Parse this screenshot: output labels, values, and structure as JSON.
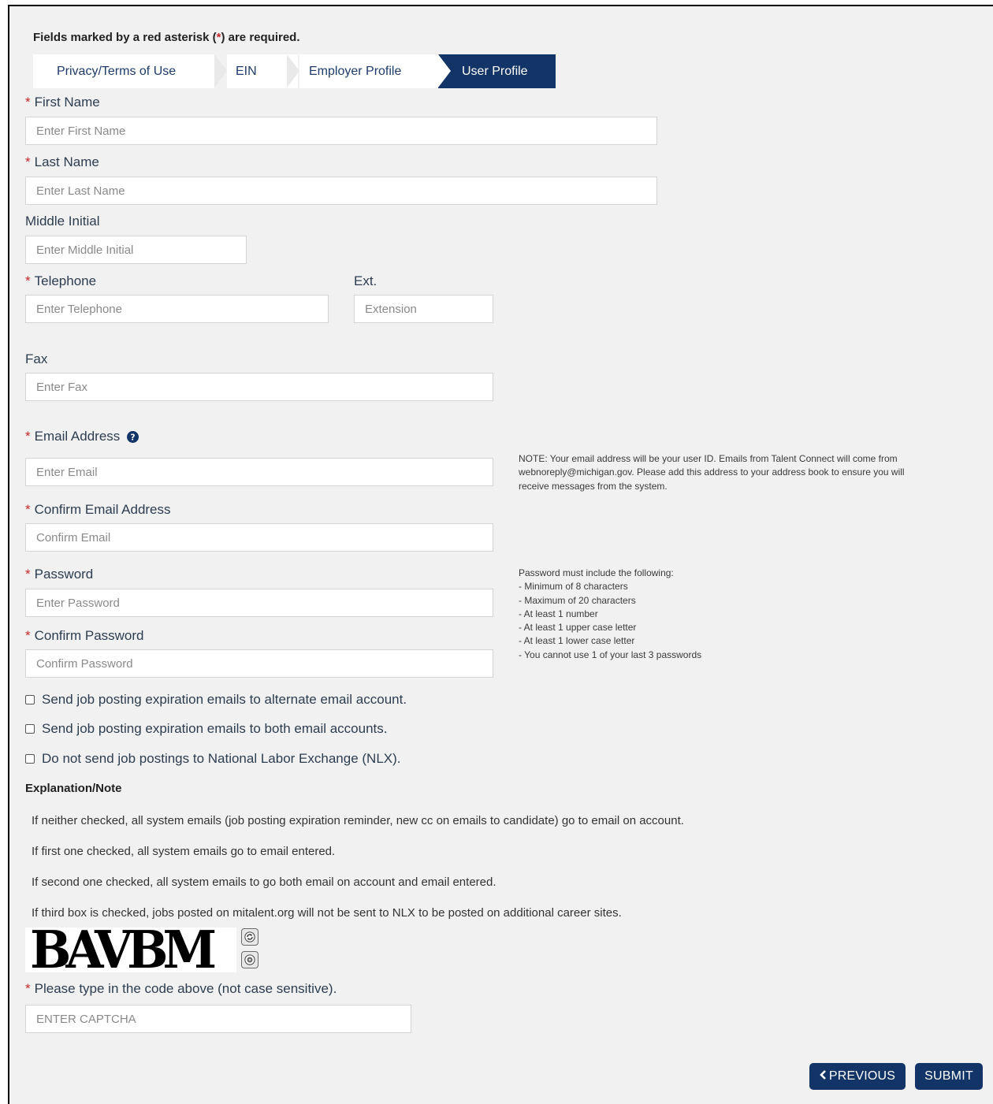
{
  "required_note": {
    "prefix": "Fields marked by a red asterisk (",
    "asterisk": "*",
    "suffix": ") are required."
  },
  "steps": [
    {
      "label": "Privacy/Terms of Use",
      "active": false
    },
    {
      "label": "EIN",
      "active": false
    },
    {
      "label": "Employer Profile",
      "active": false
    },
    {
      "label": "User Profile",
      "active": true
    }
  ],
  "fields": {
    "first_name": {
      "label": "First Name",
      "placeholder": "Enter First Name",
      "value": ""
    },
    "last_name": {
      "label": "Last Name",
      "placeholder": "Enter Last Name",
      "value": ""
    },
    "middle_initial": {
      "label": "Middle Initial",
      "placeholder": "Enter Middle Initial",
      "value": ""
    },
    "telephone": {
      "label": "Telephone",
      "placeholder": "Enter Telephone",
      "value": ""
    },
    "extension": {
      "label": "Ext.",
      "placeholder": "Extension",
      "value": ""
    },
    "fax": {
      "label": "Fax",
      "placeholder": "Enter Fax",
      "value": ""
    },
    "email": {
      "label": "Email Address",
      "placeholder": "Enter Email",
      "value": ""
    },
    "confirm_email": {
      "label": "Confirm Email Address",
      "placeholder": "Confirm Email",
      "value": ""
    },
    "password": {
      "label": "Password",
      "placeholder": "Enter Password",
      "value": ""
    },
    "confirm_password": {
      "label": "Confirm Password",
      "placeholder": "Confirm Password",
      "value": ""
    },
    "captcha": {
      "label": "Please type in the code above (not case sensitive).",
      "placeholder": "ENTER CAPTCHA",
      "value": ""
    }
  },
  "asterisk": "*",
  "email_note": {
    "line1": "NOTE: Your email address will be your user ID. Emails from Talent Connect will come from",
    "line2": "webnoreply@michigan.gov. Please add this address to your address book to ensure you will",
    "line3": "receive messages from the system."
  },
  "password_rules": {
    "title": "Password must include the following:",
    "items": [
      "- Minimum of 8 characters",
      "- Maximum of 20 characters",
      "- At least 1 number",
      "- At least 1 upper case letter",
      "- At least 1 lower case letter",
      "- You cannot use 1 of your last 3 passwords"
    ]
  },
  "checkboxes": [
    {
      "label": "Send job posting expiration emails to alternate email account.",
      "checked": false
    },
    {
      "label": "Send job posting expiration emails to both email accounts.",
      "checked": false
    },
    {
      "label": "Do not send job postings to National Labor Exchange (NLX).",
      "checked": false
    }
  ],
  "explanation": {
    "title": "Explanation/Note",
    "lines": [
      "If neither checked, all system emails (job posting expiration reminder, new cc on emails to candidate) go to email on account.",
      "If first one checked, all system emails go to email entered.",
      "If second one checked, all system emails to go both email on account and email entered.",
      "If third box is checked, jobs posted on mitalent.org will not be sent to NLX to be posted on additional career sites."
    ]
  },
  "captcha_image_text": "BAVBM",
  "icons": {
    "help": "question-circle-icon",
    "refresh": "refresh-icon",
    "audio": "audio-icon",
    "previous": "chevron-left-icon"
  },
  "buttons": {
    "previous": "PREVIOUS",
    "submit": "SUBMIT"
  },
  "colors": {
    "brand": "#123466",
    "required": "#c1272d",
    "background": "#f1f1f1"
  }
}
